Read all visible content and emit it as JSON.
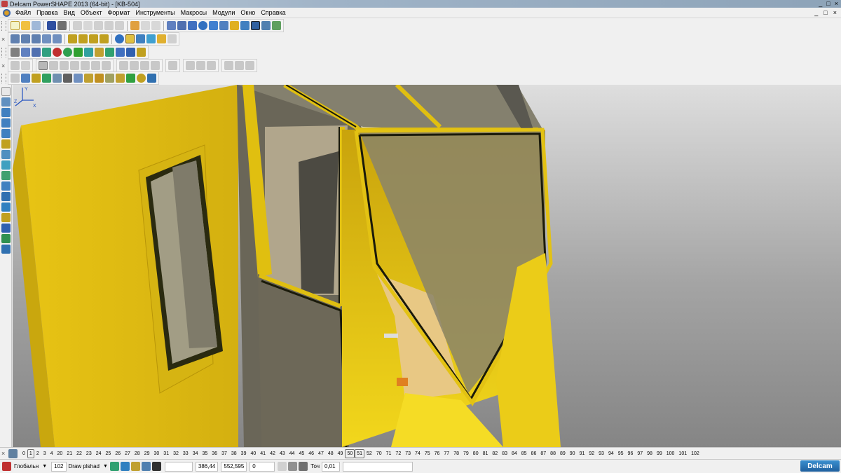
{
  "window": {
    "title": "Delcam PowerSHAPE 2013 (64-bit) - [KB-504]",
    "controls": [
      "_",
      "□",
      "×"
    ]
  },
  "menu": {
    "items": [
      "Файл",
      "Правка",
      "Вид",
      "Объект",
      "Формат",
      "Инструменты",
      "Макросы",
      "Модули",
      "Окно",
      "Справка"
    ],
    "mdi_controls": [
      "_",
      "□",
      "×"
    ]
  },
  "colors": {
    "cab_yellow": "#e8c414",
    "cab_yellow_dark": "#b8960a",
    "glass": "#7a7560",
    "interior_beige": "#b5aa90",
    "background_top": "#d8d8d8",
    "background_bottom": "#8a8a8a"
  },
  "viewport": {
    "model_name": "KB-504",
    "axis_labels": [
      "X",
      "Y",
      "Z"
    ]
  },
  "layers": {
    "icon": "pencil-icon",
    "values": [
      "0",
      "1",
      "2",
      "3",
      "4",
      "20",
      "21",
      "22",
      "23",
      "24",
      "25",
      "26",
      "27",
      "28",
      "29",
      "30",
      "31",
      "32",
      "33",
      "34",
      "35",
      "36",
      "37",
      "38",
      "39",
      "40",
      "41",
      "42",
      "43",
      "44",
      "45",
      "46",
      "47",
      "48",
      "49",
      "50",
      "51",
      "52",
      "70",
      "71",
      "72",
      "73",
      "74",
      "75",
      "76",
      "77",
      "78",
      "79",
      "80",
      "81",
      "82",
      "83",
      "84",
      "85",
      "86",
      "87",
      "88",
      "89",
      "90",
      "91",
      "92",
      "93",
      "94",
      "95",
      "96",
      "97",
      "98",
      "99",
      "100",
      "101",
      "102"
    ],
    "boxed": [
      "1",
      "50",
      "51"
    ]
  },
  "status": {
    "workplane": "Глобальн",
    "layer_number": "102",
    "layer_name": "Draw plshad",
    "coord_x": "386,44",
    "coord_y": "552,595",
    "coord_z": "0",
    "tolerance_label": "Точ",
    "tolerance_value": "0,01",
    "brand": "Delcam"
  }
}
